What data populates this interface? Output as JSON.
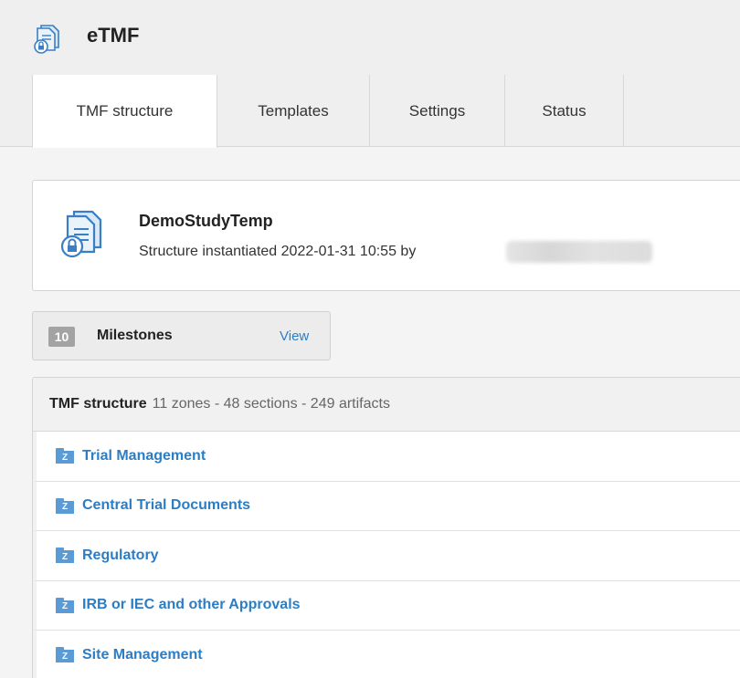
{
  "app": {
    "title": "eTMF",
    "logo_icon": "locked-documents-icon"
  },
  "tabs": [
    {
      "label": "TMF structure",
      "active": true
    },
    {
      "label": "Templates",
      "active": false
    },
    {
      "label": "Settings",
      "active": false
    },
    {
      "label": "Status",
      "active": false
    }
  ],
  "study": {
    "name": "DemoStudyTemp",
    "subtitle": "Structure instantiated 2022-01-31 10:55 by",
    "icon": "locked-documents-icon"
  },
  "milestones": {
    "count": "10",
    "label": "Milestones",
    "view_label": "View"
  },
  "tmf_structure": {
    "title": "TMF structure",
    "summary": "11 zones - 48 sections - 249 artifacts",
    "zone_badge": "Z",
    "zones": [
      {
        "name": "Trial Management"
      },
      {
        "name": "Central Trial Documents"
      },
      {
        "name": "Regulatory"
      },
      {
        "name": "IRB or IEC and other Approvals"
      },
      {
        "name": "Site Management"
      }
    ]
  },
  "colors": {
    "accent": "#2b7dc6",
    "zone_icon": "#5b9bd5",
    "badge": "#a3a3a3"
  }
}
